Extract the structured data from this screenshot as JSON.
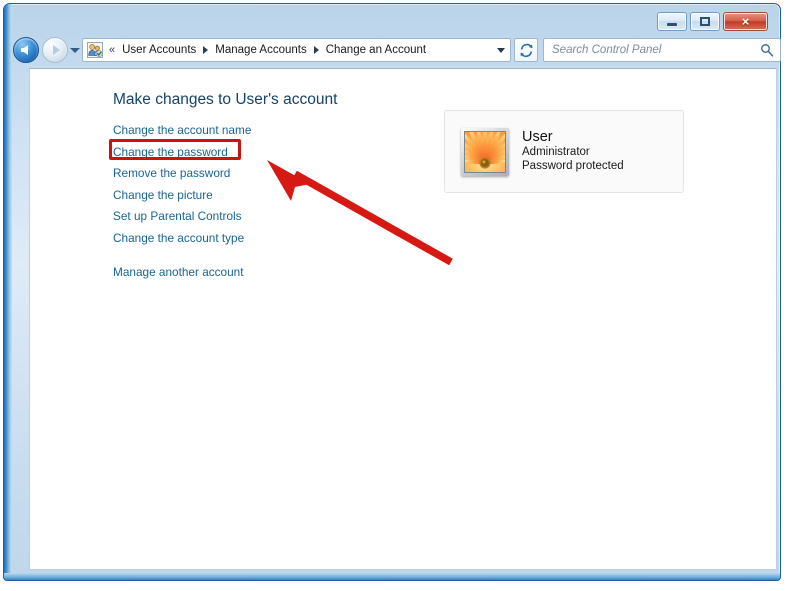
{
  "window": {
    "minimize_label": "Minimize",
    "maximize_label": "Maximize",
    "close_label": "×"
  },
  "navbar": {
    "back_label": "Back",
    "forward_label": "Forward",
    "history_label": "Recent pages",
    "breadcrumb_icon": "user-accounts-icon",
    "breadcrumb_prefix": "«",
    "breadcrumbs": [
      {
        "label": "User Accounts"
      },
      {
        "label": "Manage Accounts"
      },
      {
        "label": "Change an Account"
      }
    ],
    "address_dropdown_label": "Previous locations",
    "refresh_label": "Refresh",
    "search_placeholder": "Search Control Panel",
    "search_value": ""
  },
  "main": {
    "heading": "Make changes to User's account",
    "links": [
      {
        "label": "Change the account name"
      },
      {
        "label": "Change the password"
      },
      {
        "label": "Remove the password"
      },
      {
        "label": "Change the picture"
      },
      {
        "label": "Set up Parental Controls"
      },
      {
        "label": "Change the account type"
      },
      {
        "label": "Manage another account"
      }
    ],
    "user_card": {
      "name": "User",
      "role": "Administrator",
      "password_state": "Password protected",
      "avatar_icon": "gerbera-flower-avatar"
    }
  },
  "annotations": {
    "highlight_target": "Change the password",
    "highlight_color": "#cc1111",
    "arrow_color": "#d61a13"
  },
  "colors": {
    "link": "#1a6496",
    "heading": "#13436b",
    "frame_border": "#1a5fa3",
    "close_button": "#c03c27"
  }
}
